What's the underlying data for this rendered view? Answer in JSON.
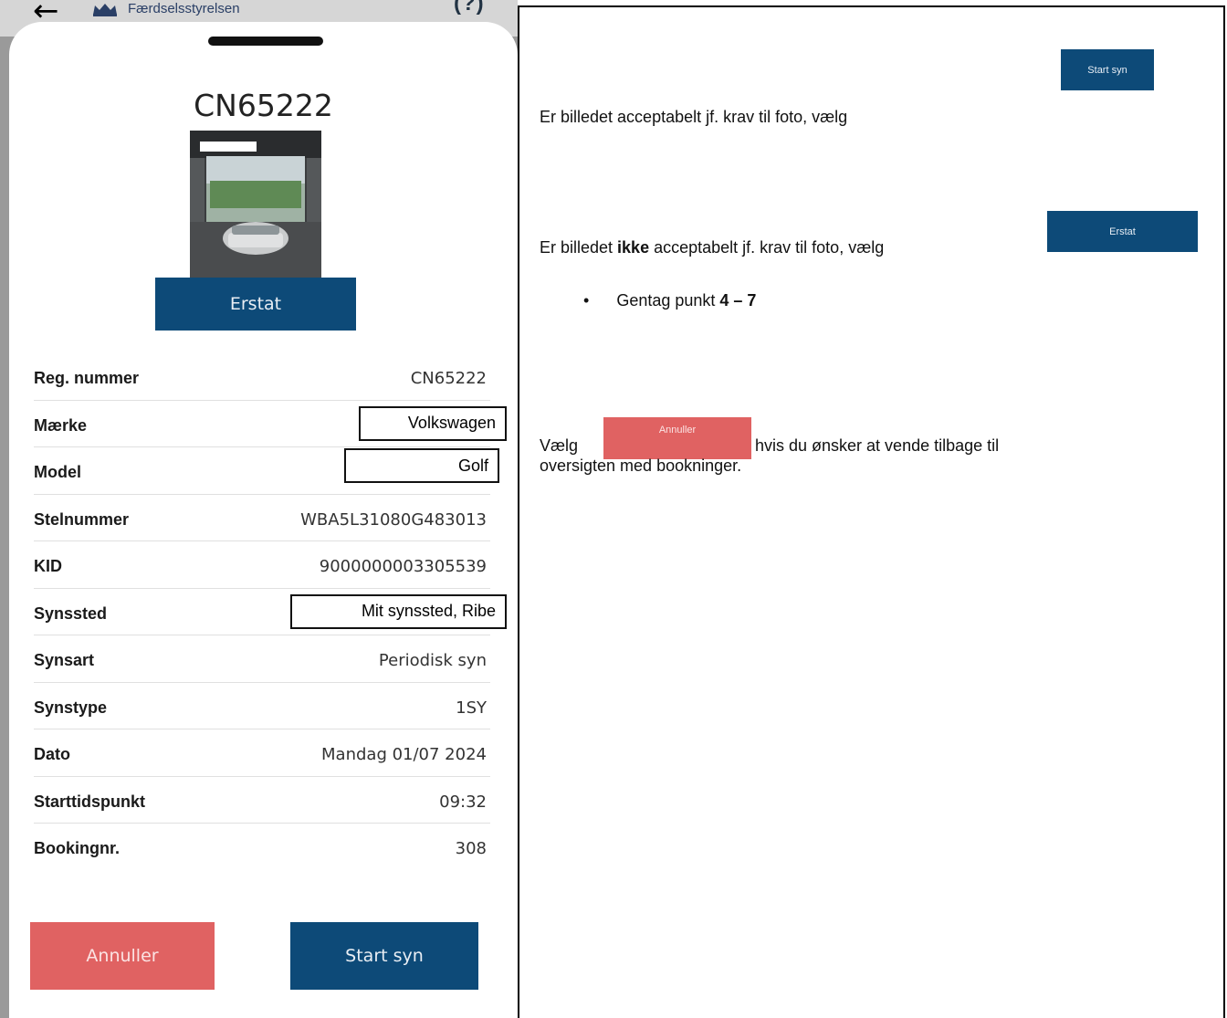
{
  "phone": {
    "agency_name": "Færdselsstyrelsen",
    "help_label": "(?)",
    "plate_title": "CN65222",
    "replace_label": "Erstat",
    "cancel_label": "Annuller",
    "start_label": "Start syn",
    "details": [
      {
        "label": "Reg. nummer",
        "value": "CN65222"
      },
      {
        "label": "Mærke",
        "value": "Volkswagen"
      },
      {
        "label": "Model",
        "value": "Golf"
      },
      {
        "label": "Stelnummer",
        "value": "WBA5L31080G483013"
      },
      {
        "label": "KID",
        "value": "9000000003305539"
      },
      {
        "label": "Synssted",
        "value": "Mit synssted, Ribe"
      },
      {
        "label": "Synsart",
        "value": "Periodisk syn"
      },
      {
        "label": "Synstype",
        "value": "1SY"
      },
      {
        "label": "Dato",
        "value": "Mandag 01/07 2024"
      },
      {
        "label": "Starttidspunkt",
        "value": "09:32"
      },
      {
        "label": "Bookingnr.",
        "value": "308"
      }
    ]
  },
  "instructions": {
    "accept": {
      "text": "Er billedet acceptabelt jf. krav til foto, vælg",
      "button": "Start syn"
    },
    "reject": {
      "before": "Er billedet ",
      "emphasis": "ikke",
      "after": " acceptabelt jf. krav til foto, vælg",
      "button": "Erstat"
    },
    "repeat": {
      "bullet": "•",
      "text": "Gentag punkt ",
      "range": "4 – 7"
    },
    "cancel": {
      "before": "Vælg",
      "button": "Annuller",
      "after": "hvis du ønsker at vende tilbage til",
      "line2": "oversigten med bookninger."
    }
  },
  "colors": {
    "primary": "#0d4a78",
    "danger": "#e06262"
  },
  "icons": [
    "back-arrow-icon",
    "crown-icon",
    "help-icon"
  ]
}
